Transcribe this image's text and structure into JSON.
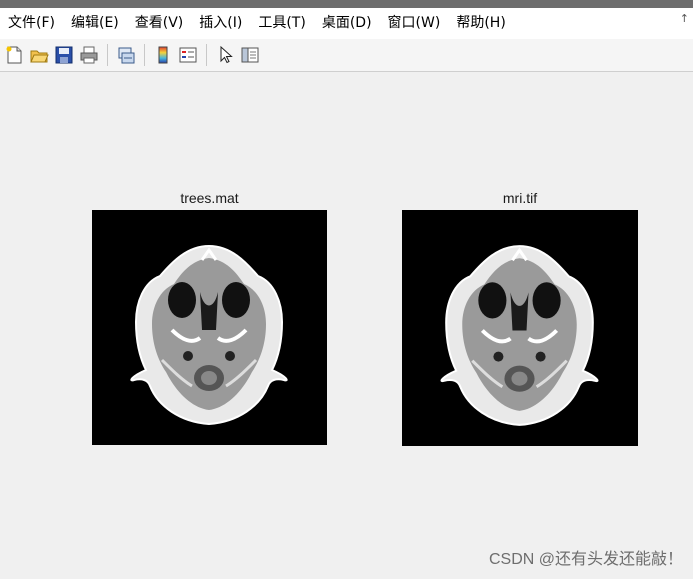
{
  "menu": {
    "items": [
      {
        "label": "文件(F)"
      },
      {
        "label": "编辑(E)"
      },
      {
        "label": "查看(V)"
      },
      {
        "label": "插入(I)"
      },
      {
        "label": "工具(T)"
      },
      {
        "label": "桌面(D)"
      },
      {
        "label": "窗口(W)"
      },
      {
        "label": "帮助(H)"
      }
    ],
    "overflow_glyph": "↑"
  },
  "toolbar": {
    "buttons": [
      {
        "icon": "new-figure-icon"
      },
      {
        "icon": "open-file-icon"
      },
      {
        "icon": "save-icon"
      },
      {
        "icon": "print-icon"
      },
      {
        "icon": "link-plot-icon"
      },
      {
        "icon": "colorbar-icon"
      },
      {
        "icon": "legend-icon"
      },
      {
        "icon": "pointer-icon"
      },
      {
        "icon": "property-editor-icon"
      }
    ]
  },
  "axes": [
    {
      "title": "trees.mat",
      "image": "MRI axial head slice"
    },
    {
      "title": "mri.tif",
      "image": "MRI axial head slice"
    }
  ],
  "watermark": "CSDN @还有头发还能敲！"
}
